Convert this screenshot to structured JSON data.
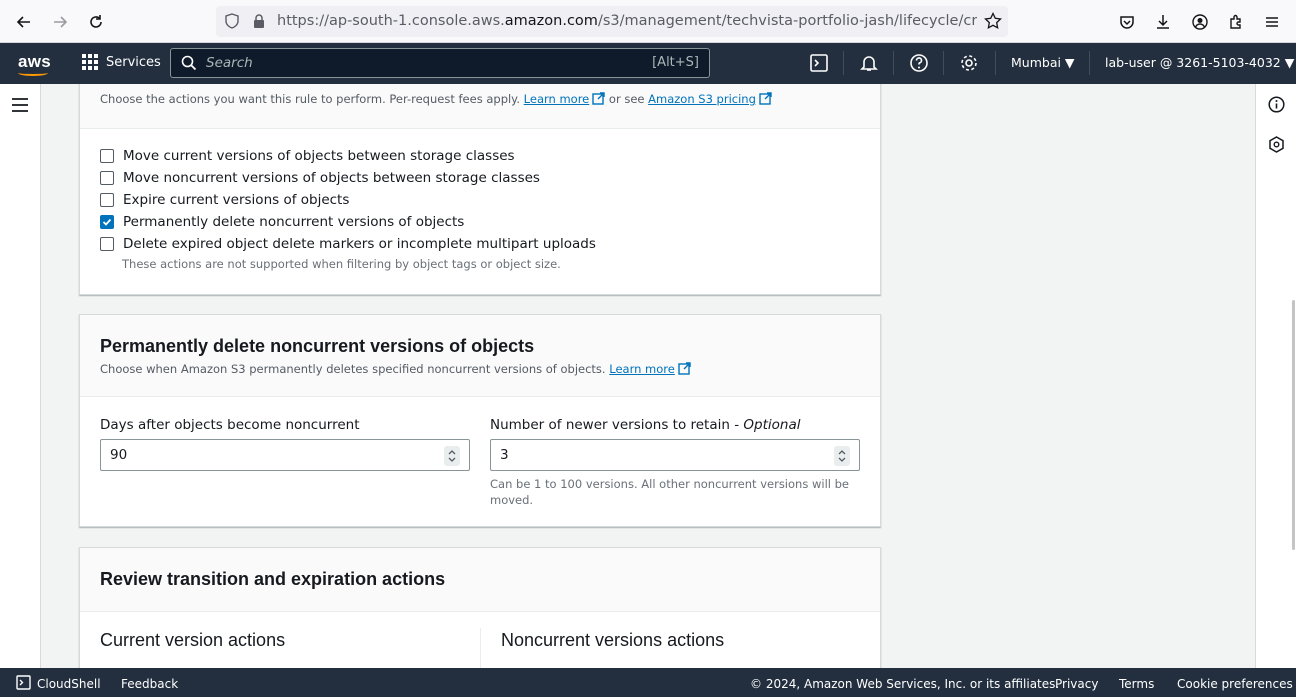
{
  "browser": {
    "url_prefix": "https://ap-south-1.console.aws.",
    "url_domain": "amazon.com",
    "url_path": "/s3/management/techvista-portfolio-jash/lifecycle/crea"
  },
  "aws_nav": {
    "logo": "aws",
    "services": "Services",
    "search_placeholder": "Search",
    "search_shortcut": "[Alt+S]",
    "region": "Mumbai ▼",
    "account": "lab-user @ 3261-5103-4032 ▼"
  },
  "actions_panel": {
    "description": "Choose the actions you want this rule to perform. Per-request fees apply.",
    "learn_more": "Learn more",
    "or_see": "or see",
    "pricing_link": "Amazon S3 pricing",
    "options": [
      {
        "label": "Move current versions of objects between storage classes",
        "checked": false
      },
      {
        "label": "Move noncurrent versions of objects between storage classes",
        "checked": false
      },
      {
        "label": "Expire current versions of objects",
        "checked": false
      },
      {
        "label": "Permanently delete noncurrent versions of objects",
        "checked": true
      },
      {
        "label": "Delete expired object delete markers or incomplete multipart uploads",
        "checked": false
      }
    ],
    "note": "These actions are not supported when filtering by object tags or object size."
  },
  "delete_panel": {
    "title": "Permanently delete noncurrent versions of objects",
    "description": "Choose when Amazon S3 permanently deletes specified noncurrent versions of objects.",
    "learn_more": "Learn more",
    "days_label": "Days after objects become noncurrent",
    "days_value": "90",
    "versions_label": "Number of newer versions to retain - ",
    "versions_label_optional": "Optional",
    "versions_value": "3",
    "versions_help": "Can be 1 to 100 versions. All other noncurrent versions will be moved."
  },
  "review_panel": {
    "title": "Review transition and expiration actions",
    "current_heading": "Current version actions",
    "noncurrent_heading": "Noncurrent versions actions"
  },
  "footer": {
    "cloudshell": "CloudShell",
    "feedback": "Feedback",
    "copyright": "© 2024, Amazon Web Services, Inc. or its affiliates.",
    "privacy": "Privacy",
    "terms": "Terms",
    "cookies": "Cookie preferences"
  },
  "colors": {
    "aws_nav": "#232f3e",
    "accent": "#0073bb",
    "aws_orange": "#ff9900"
  }
}
